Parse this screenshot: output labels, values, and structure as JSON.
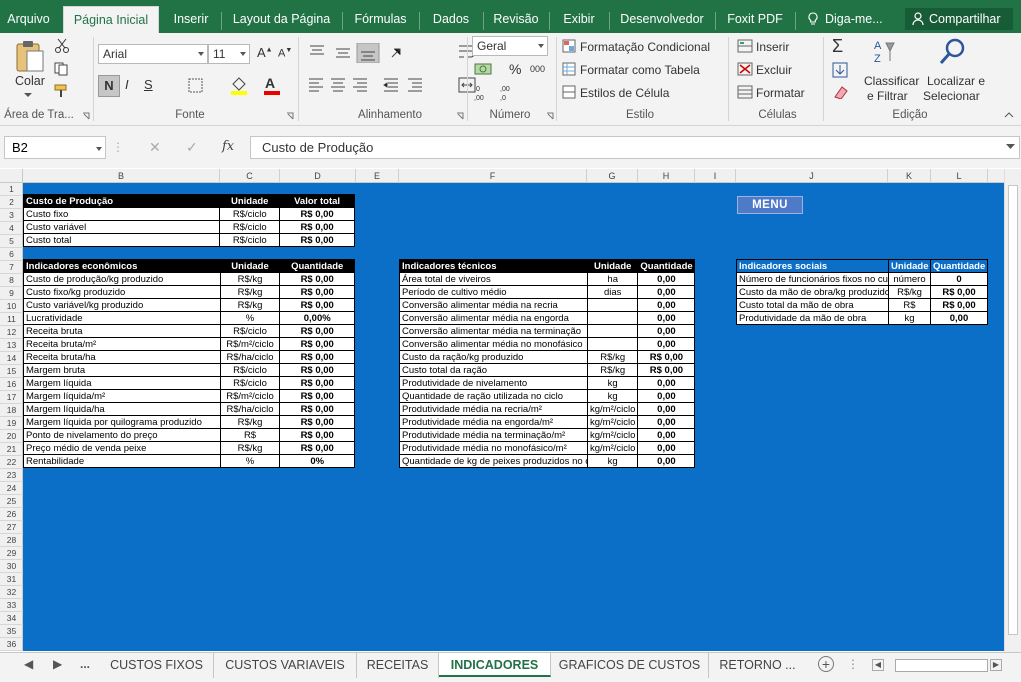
{
  "menu": {
    "tabs": [
      "Arquivo",
      "Página Inicial",
      "Inserir",
      "Layout da Página",
      "Fórmulas",
      "Dados",
      "Revisão",
      "Exibir",
      "Desenvolvedor",
      "Foxit PDF"
    ],
    "tell_me": "Diga-me...",
    "share": "Compartilhar"
  },
  "ribbon": {
    "paste": "Colar",
    "clipboard_label": "Área de Tra...",
    "font_name": "Arial",
    "font_size": "11",
    "bold": "N",
    "italic": "I",
    "underline": "S",
    "font_label": "Fonte",
    "alignment_label": "Alinhamento",
    "number_format": "Geral",
    "percent": "%",
    "thousands": "000",
    "number_label": "Número",
    "cond_format": "Formatação Condicional",
    "format_table": "Formatar como Tabela",
    "cell_styles": "Estilos de Célula",
    "styles_label": "Estilo",
    "insert": "Inserir",
    "delete": "Excluir",
    "format": "Formatar",
    "cells_label": "Células",
    "sort_line1": "Classificar",
    "sort_line2": "e Filtrar",
    "find_line1": "Localizar e",
    "find_line2": "Selecionar",
    "editing_label": "Edição"
  },
  "formula_bar": {
    "name_box": "B2",
    "fx": "fx",
    "content": "Custo de Produção"
  },
  "columns": [
    "B",
    "C",
    "D",
    "E",
    "F",
    "G",
    "H",
    "I",
    "J",
    "K",
    "L"
  ],
  "rows": [
    "1",
    "2",
    "3",
    "4",
    "5",
    "6",
    "7",
    "8",
    "9",
    "10",
    "11",
    "12",
    "13",
    "14",
    "15",
    "16",
    "17",
    "18",
    "19",
    "20",
    "21",
    "22",
    "23",
    "24",
    "25",
    "26",
    "27",
    "28",
    "29",
    "30",
    "31",
    "32",
    "33",
    "34",
    "35",
    "36"
  ],
  "menu_button": "MENU",
  "custo": {
    "headers": [
      "Custo de Produção",
      "Unidade",
      "Valor total"
    ],
    "rows": [
      [
        "Custo fixo",
        "R$/ciclo",
        "R$ 0,00"
      ],
      [
        "Custo variável",
        "R$/ciclo",
        "R$ 0,00"
      ],
      [
        "Custo total",
        "R$/ciclo",
        "R$ 0,00"
      ]
    ]
  },
  "economicos": {
    "headers": [
      "Indicadores econômicos",
      "Unidade",
      "Quantidade"
    ],
    "rows": [
      [
        "Custo de produção/kg produzido",
        "R$/kg",
        "R$ 0,00"
      ],
      [
        "Custo fixo/kg produzido",
        "R$/kg",
        "R$ 0,00"
      ],
      [
        "Custo variável/kg produzido",
        "R$/kg",
        "R$ 0,00"
      ],
      [
        "Lucratividade",
        "%",
        "0,00%"
      ],
      [
        "Receita bruta",
        "R$/ciclo",
        "R$ 0,00"
      ],
      [
        "Receita bruta/m²",
        "R$/m²/ciclo",
        "R$ 0,00"
      ],
      [
        "Receita bruta/ha",
        "R$/ha/ciclo",
        "R$ 0,00"
      ],
      [
        "Margem bruta",
        "R$/ciclo",
        "R$ 0,00"
      ],
      [
        "Margem líquida",
        "R$/ciclo",
        "R$ 0,00"
      ],
      [
        "Margem líquida/m²",
        "R$/m²/ciclo",
        "R$ 0,00"
      ],
      [
        "Margem líquida/ha",
        "R$/ha/ciclo",
        "R$ 0,00"
      ],
      [
        "Margem líquida por quilograma produzido",
        "R$/kg",
        "R$ 0,00"
      ],
      [
        "Ponto de nivelamento do preço",
        "R$",
        "R$ 0,00"
      ],
      [
        "Preço médio de venda peixe",
        "R$/kg",
        "R$ 0,00"
      ],
      [
        "Rentabilidade",
        "%",
        "0%"
      ]
    ]
  },
  "tecnicos": {
    "headers": [
      "Indicadores técnicos",
      "Unidade",
      "Quantidade"
    ],
    "rows": [
      [
        "Área total de viveiros",
        "ha",
        "0,00"
      ],
      [
        "Período de cultivo médio",
        "dias",
        "0,00"
      ],
      [
        "Conversão alimentar média na recria",
        "",
        "0,00"
      ],
      [
        "Conversão alimentar média na engorda",
        "",
        "0,00"
      ],
      [
        "Conversão alimentar média na terminação",
        "",
        "0,00"
      ],
      [
        "Conversão alimentar média no monofásico",
        "",
        "0,00"
      ],
      [
        "Custo da ração/kg produzido",
        "R$/kg",
        "R$ 0,00"
      ],
      [
        "Custo total da ração",
        "R$/kg",
        "R$ 0,00"
      ],
      [
        "Produtividade de nivelamento",
        "kg",
        "0,00"
      ],
      [
        "Quantidade de ração utilizada no ciclo",
        "kg",
        "0,00"
      ],
      [
        "Produtividade média na recria/m²",
        "kg/m²/ciclo",
        "0,00"
      ],
      [
        "Produtividade média na engorda/m²",
        "kg/m²/ciclo",
        "0,00"
      ],
      [
        "Produtividade média na terminação/m²",
        "kg/m²/ciclo",
        "0,00"
      ],
      [
        "Produtividade média no monofásico/m²",
        "kg/m²/ciclo",
        "0,00"
      ],
      [
        "Quantidade de kg de peixes produzidos no ciclo",
        "kg",
        "0,00"
      ]
    ]
  },
  "sociais": {
    "headers": [
      "Indicadores sociais",
      "Unidade",
      "Quantidade"
    ],
    "rows": [
      [
        "Número de funcionários fixos no cultivo",
        "número",
        "0"
      ],
      [
        "Custo da mão de obra/kg produzido",
        "R$/kg",
        "R$ 0,00"
      ],
      [
        "Custo total da mão de obra",
        "R$",
        "R$ 0,00"
      ],
      [
        "Produtividade da mão de obra",
        "kg",
        "0,00"
      ]
    ]
  },
  "sheets": {
    "more": "...",
    "tabs": [
      "CUSTOS FIXOS",
      "CUSTOS VARIAVEIS",
      "RECEITAS",
      "INDICADORES",
      "GRAFICOS DE CUSTOS",
      "RETORNO ..."
    ],
    "active_index": 3
  },
  "colors": {
    "brand": "#217346",
    "sheet_bg": "#0b6ec7",
    "menu_btn": "#4e7ac7"
  }
}
